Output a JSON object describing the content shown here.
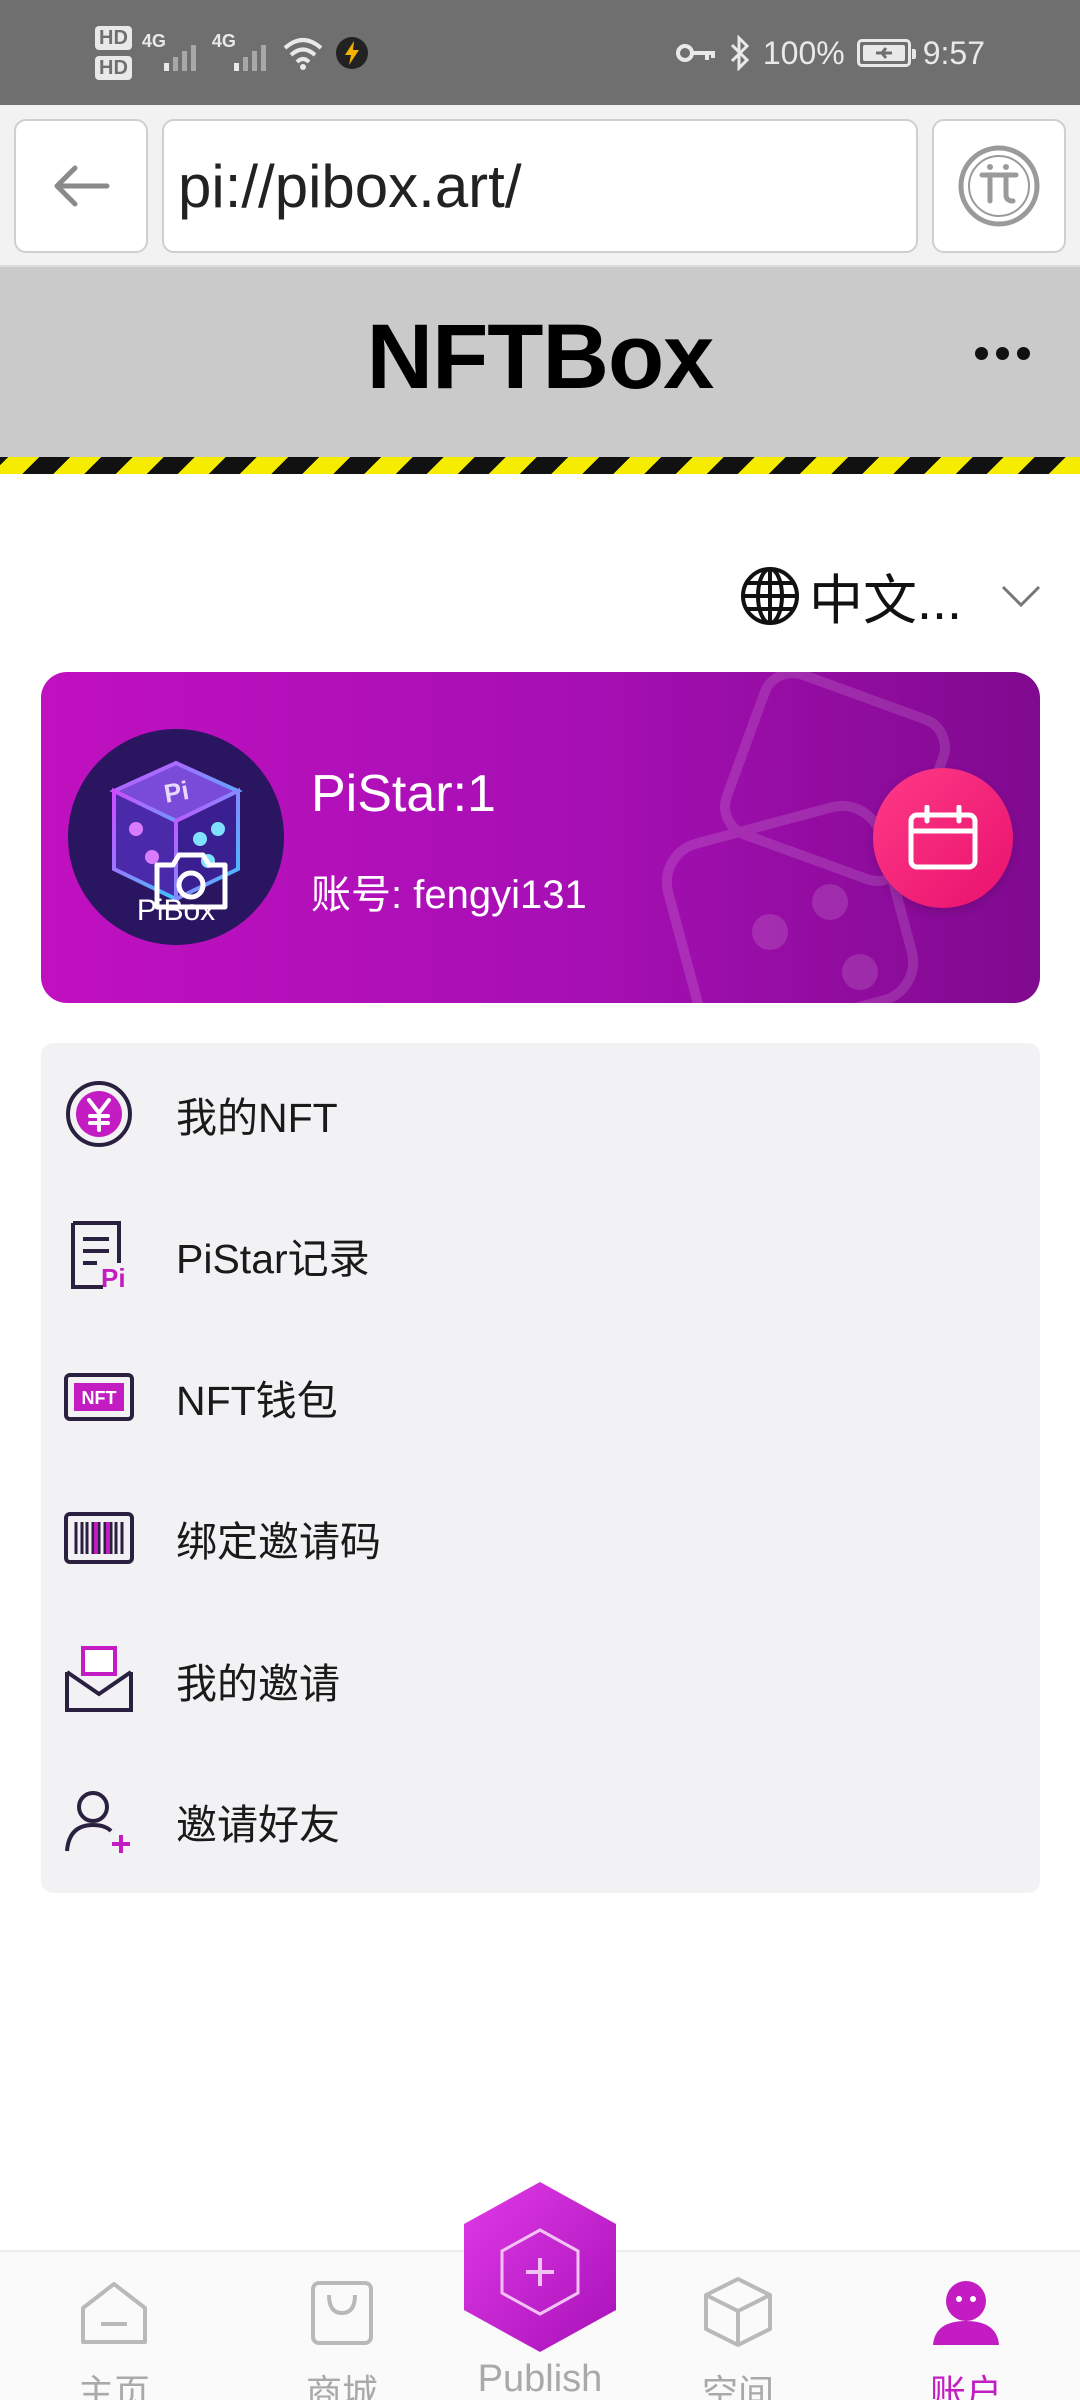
{
  "status_bar": {
    "sim1": "HD",
    "sim2": "HD",
    "net1": "4G",
    "net2": "4G",
    "battery_text": "100%",
    "time": "9:57",
    "icons": [
      "key-icon",
      "bluetooth-icon",
      "battery-icon",
      "wifi-icon",
      "charge-icon"
    ]
  },
  "browser": {
    "url": "pi://pibox.art/",
    "back_icon": "arrow-left-icon",
    "pi_icon": "pi-logo-icon"
  },
  "header": {
    "title": "NFTBox",
    "more_icon": "more-dots-icon"
  },
  "language": {
    "label": "中文...",
    "icon": "globe-icon"
  },
  "profile": {
    "avatar_label": "PiBox",
    "pistar": "PiStar:1",
    "account": "账号: fengyi131",
    "accent": "#c010c0",
    "calendar_color": "#ff3a86"
  },
  "menu": {
    "items": [
      {
        "label": "我的NFT",
        "icon": "yen-coin-icon"
      },
      {
        "label": "PiStar记录",
        "icon": "pi-record-icon"
      },
      {
        "label": "NFT钱包",
        "icon": "nft-wallet-icon"
      },
      {
        "label": "绑定邀请码",
        "icon": "barcode-icon"
      },
      {
        "label": "我的邀请",
        "icon": "invitation-envelope-icon"
      },
      {
        "label": "邀请好友",
        "icon": "add-user-icon"
      }
    ]
  },
  "bottom_nav": {
    "items": [
      {
        "label": "主页",
        "icon": "home-icon"
      },
      {
        "label": "商城",
        "icon": "shopping-bag-icon"
      },
      {
        "label": "空间",
        "icon": "cube-icon"
      },
      {
        "label": "账户",
        "icon": "account-icon"
      }
    ],
    "publish_label": "Publish",
    "active": "账户",
    "active_color": "#c21cc2",
    "inactive_color": "#a9a9a9"
  }
}
